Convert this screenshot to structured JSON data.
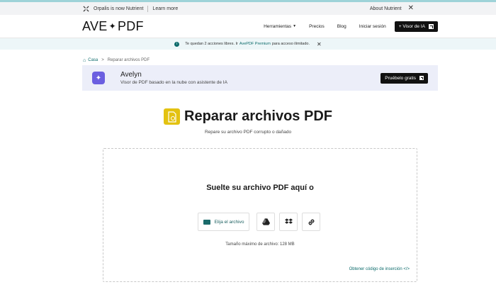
{
  "announce": {
    "brand_text": "Orpalis is now Nutrient",
    "learn_more": "Learn more",
    "about": "About Nutrient",
    "close": "✕"
  },
  "nav": {
    "brand_left": "AVE",
    "brand_star": "✦",
    "brand_right": "PDF",
    "tools": "Herramientas",
    "pricing": "Precios",
    "blog": "Blog",
    "login": "Iniciar sesión",
    "ai_viewer": "+ Visor de IA"
  },
  "notice": {
    "text_before": "Te quedan 2 acciones libres. Ir",
    "link": "AvePDF Premium",
    "text_after": "para acceso ilimitado.",
    "close": "✕"
  },
  "breadcrumb": {
    "home": "Casa",
    "arrow": ">",
    "current": "Reparar archivos PDF"
  },
  "promo": {
    "title": "Avelyn",
    "subtitle": "Visor de PDF basado en la nube con asistente de IA",
    "cta": "Pruébelo gratis"
  },
  "hero": {
    "title": "Reparar archivos PDF",
    "subtitle": "Repare su archivo PDF corrupto o dañado"
  },
  "drop": {
    "title": "Suelte su archivo PDF aquí o",
    "choose": "Elija el archivo",
    "max_size": "Tamaño máximo de archivo: 128 MB",
    "embed": "Obtener código de inserción </>"
  },
  "colors": {
    "accent": "#0d6b6b",
    "tool_icon": "#e3c211",
    "promo_bg": "#eceef9",
    "promo_icon": "#6b5fe0"
  }
}
